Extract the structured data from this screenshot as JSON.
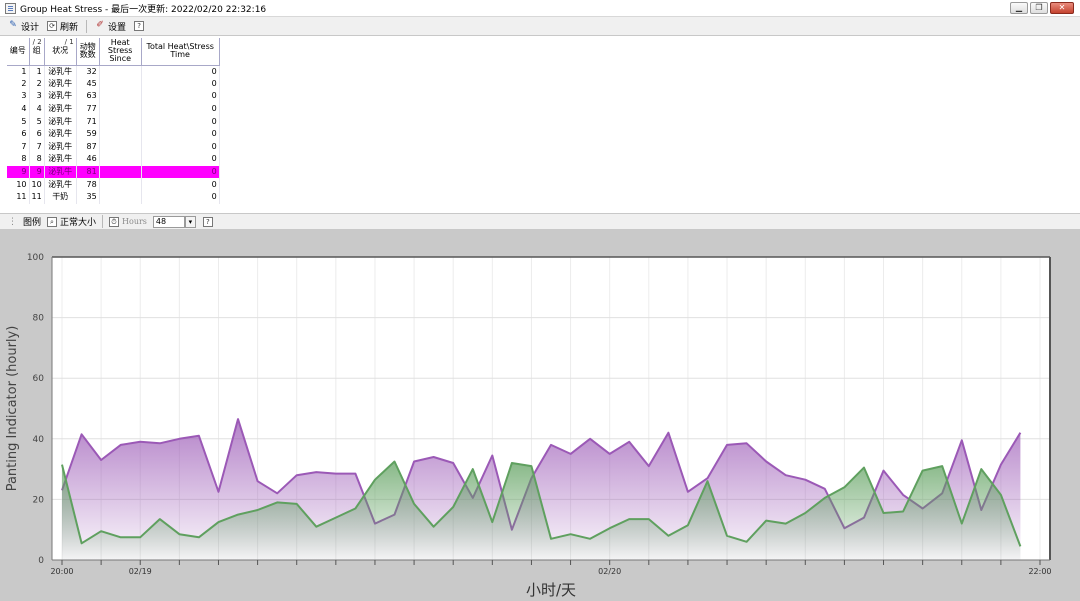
{
  "window": {
    "title": "Group Heat Stress - 最后一次更新: 2022/02/20 22:32:16",
    "buttons": [
      "▁",
      "❐",
      "✕"
    ]
  },
  "toolbar": {
    "design_label": "设计",
    "refresh_label": "刷新",
    "settings_label": "设置",
    "help_label": "?"
  },
  "table": {
    "headers": {
      "id": "编号",
      "group": "组",
      "group_sort": "/ 2",
      "status": "状况",
      "status_sort": "/ 1",
      "animal_count": "动物\n数数",
      "heat_stress_since": "Heat Stress Since",
      "total_time": "Total Heat\\Stress Time"
    },
    "rows": [
      {
        "id": "1",
        "group": "1",
        "status": "泌乳牛",
        "count": "32",
        "since": "",
        "total": "0"
      },
      {
        "id": "2",
        "group": "2",
        "status": "泌乳牛",
        "count": "45",
        "since": "",
        "total": "0"
      },
      {
        "id": "3",
        "group": "3",
        "status": "泌乳牛",
        "count": "63",
        "since": "",
        "total": "0"
      },
      {
        "id": "4",
        "group": "4",
        "status": "泌乳牛",
        "count": "77",
        "since": "",
        "total": "0"
      },
      {
        "id": "5",
        "group": "5",
        "status": "泌乳牛",
        "count": "71",
        "since": "",
        "total": "0"
      },
      {
        "id": "6",
        "group": "6",
        "status": "泌乳牛",
        "count": "59",
        "since": "",
        "total": "0"
      },
      {
        "id": "7",
        "group": "7",
        "status": "泌乳牛",
        "count": "87",
        "since": "",
        "total": "0"
      },
      {
        "id": "8",
        "group": "8",
        "status": "泌乳牛",
        "count": "46",
        "since": "",
        "total": "0"
      },
      {
        "id": "9",
        "group": "9",
        "status": "泌乳牛",
        "count": "81",
        "since": "",
        "total": "0",
        "selected": true
      },
      {
        "id": "10",
        "group": "10",
        "status": "泌乳牛",
        "count": "78",
        "since": "",
        "total": "0"
      },
      {
        "id": "11",
        "group": "11",
        "status": "干奶",
        "count": "35",
        "since": "",
        "total": "0"
      }
    ],
    "selected_color": "#ff00ff"
  },
  "chart_toolbar": {
    "legend_label": "图例",
    "normal_size_label": "正常大小",
    "hours_label": "Hours",
    "hours_value": "48",
    "help_label": "?"
  },
  "chart_data": {
    "type": "area",
    "xlabel": "小时/天",
    "ylabel": "Panting Indicator (hourly)",
    "ylim": [
      0,
      100
    ],
    "yticks": [
      0,
      20,
      40,
      60,
      80,
      100
    ],
    "x_tick_labels": [
      {
        "label": "20:00",
        "hour": 0
      },
      {
        "label": "02/19",
        "hour": 4
      },
      {
        "label": "02/20",
        "hour": 28
      },
      {
        "label": "22:00",
        "hour": 50
      }
    ],
    "x_range_hours": [
      0,
      50
    ],
    "grid": true,
    "series": [
      {
        "color": "#9b59b6",
        "values": [
          23,
          41.5,
          33,
          38,
          39,
          38.5,
          40,
          41,
          22.5,
          46.5,
          26,
          22,
          28,
          29,
          28.5,
          28.5,
          12,
          15,
          32.5,
          34,
          32,
          20.5,
          34.5,
          10,
          27,
          38,
          35,
          40,
          35,
          39,
          31,
          42,
          22.5,
          27,
          38,
          38.5,
          32.5,
          28,
          26.5,
          23.5,
          10.5,
          14,
          29.5,
          21.5,
          17,
          22,
          39.5,
          16.5,
          31.5,
          42
        ]
      },
      {
        "color": "#5fa05f",
        "values": [
          31.5,
          5.5,
          9.5,
          7.5,
          7.5,
          13.5,
          8.5,
          7.5,
          12.5,
          15,
          16.5,
          19,
          18.5,
          11,
          14,
          17,
          26.5,
          32.5,
          18.5,
          11,
          17.5,
          30,
          12.5,
          32,
          31,
          7,
          8.5,
          7,
          10.5,
          13.5,
          13.5,
          8,
          11.5,
          26,
          8,
          6,
          13,
          12,
          15.5,
          20.5,
          24,
          30.5,
          15.5,
          16,
          29.5,
          31,
          12,
          30,
          21.5,
          4.5
        ]
      }
    ]
  }
}
